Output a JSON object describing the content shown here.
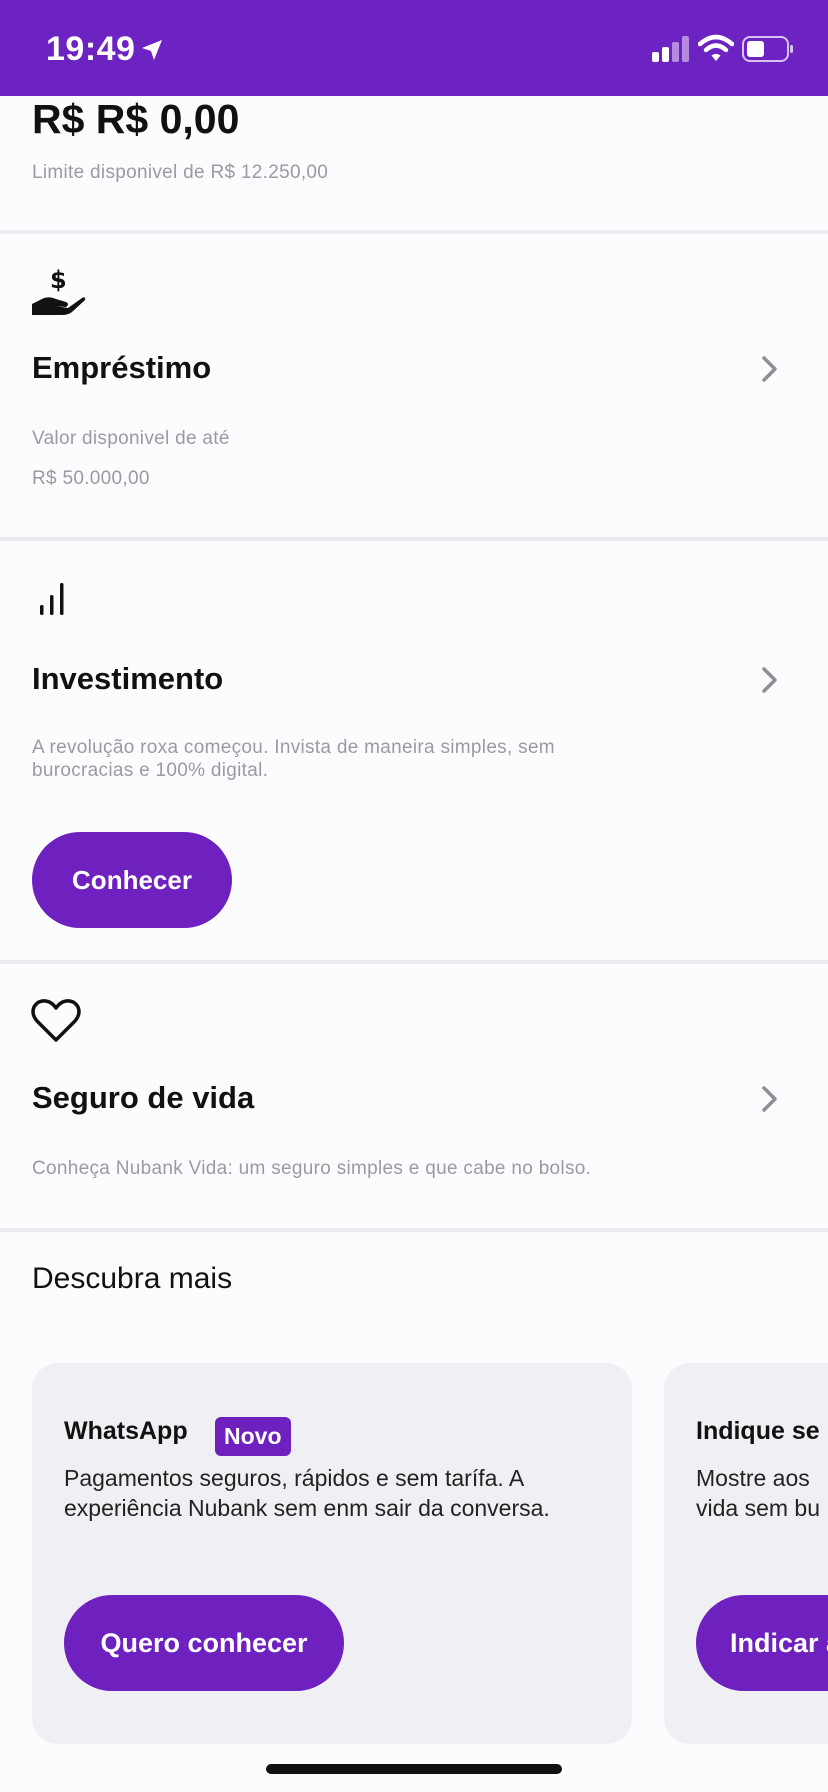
{
  "status_bar": {
    "time": "19:49"
  },
  "credit_card": {
    "amount": "R$ R$ 0,00",
    "limit_text": "Limite disponivel de R$ 12.250,00"
  },
  "loan": {
    "icon": "money-hand-icon",
    "title": "Empréstimo",
    "subtitle": "Valor disponivel de até",
    "value": "R$ 50.000,00"
  },
  "investment": {
    "icon": "bar-chart-icon",
    "title": "Investimento",
    "description_line1": "A revolução roxa começou. Invista de maneira simples, sem",
    "description_line2": "burocracias e 100% digital.",
    "button_label": "Conhecer"
  },
  "life_insurance": {
    "icon": "heart-icon",
    "title": "Seguro de vida",
    "description": "Conheça Nubank Vida: um seguro simples e que cabe no bolso."
  },
  "discover": {
    "title": "Descubra mais",
    "cards": [
      {
        "title": "WhatsApp",
        "badge": "Novo",
        "text_line1": "Pagamentos seguros, rápidos e sem tarífa. A",
        "text_line2": "experiência Nubank sem enm sair da conversa.",
        "button_label": "Quero conhecer"
      },
      {
        "title": "Indique se",
        "text_line1": "Mostre aos",
        "text_line2": "vida sem bu",
        "button_label": "Indicar a"
      }
    ]
  },
  "colors": {
    "brand_purple": "#6f21c0",
    "status_bar": "#6d22c2",
    "background": "#fcfcfe",
    "muted_text": "#9a9aa2"
  }
}
